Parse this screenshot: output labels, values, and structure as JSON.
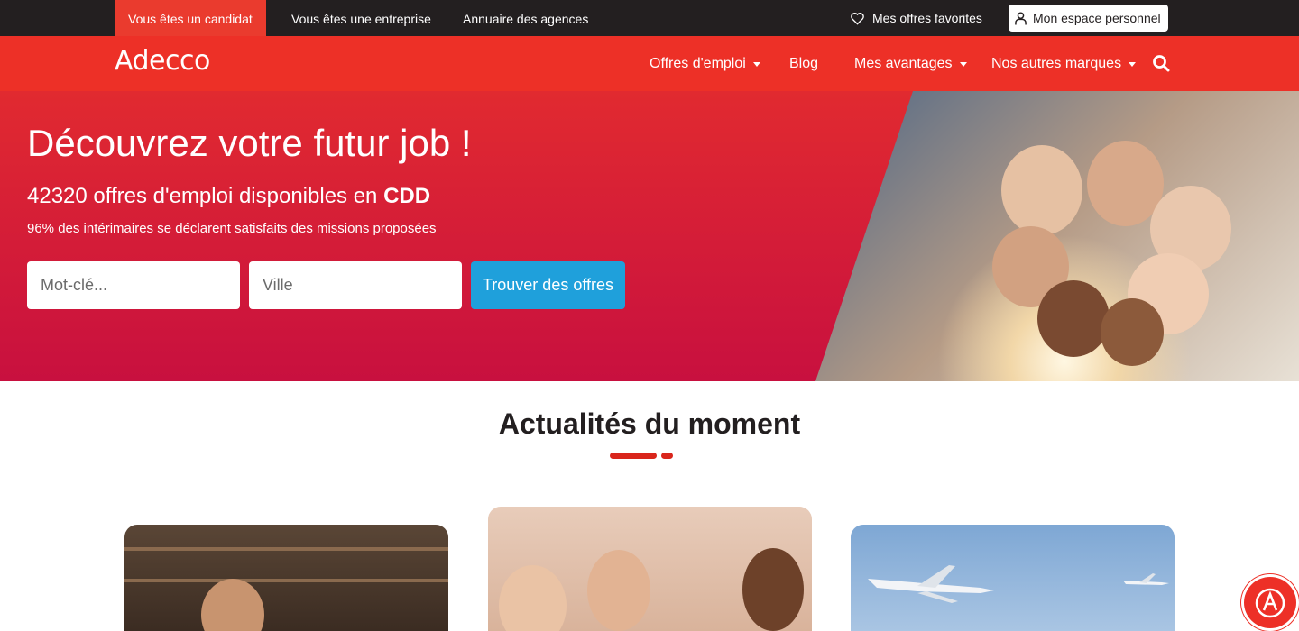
{
  "topbar": {
    "tabs": [
      "Vous êtes un candidat",
      "Vous êtes une entreprise",
      "Annuaire des agences"
    ],
    "favorites": "Mes offres favorites",
    "account": "Mon espace personnel"
  },
  "nav": {
    "logo": "Adecco",
    "items": [
      "Offres d'emploi",
      "Blog",
      "Mes avantages",
      "Nos autres marques"
    ]
  },
  "hero": {
    "title": "Découvrez votre futur job  !",
    "subtitle_prefix": "42320 offres d'emploi disponibles en ",
    "subtitle_bold": "CDD",
    "tagline": "96% des intérimaires se déclarent satisfaits des missions proposées",
    "keyword_placeholder": "Mot-clé...",
    "city_placeholder": "Ville",
    "search_button": "Trouver des offres"
  },
  "news": {
    "title": "Actualités du moment"
  },
  "colors": {
    "brand_red": "#ed3027",
    "topbar": "#231f20",
    "cta_blue": "#1fa0db"
  }
}
